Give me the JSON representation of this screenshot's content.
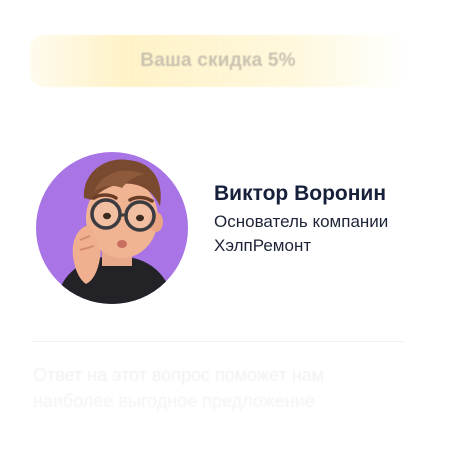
{
  "discount": {
    "label": "Ваша скидка 5%"
  },
  "author": {
    "name": "Виктор Воронин",
    "role_line1": "Основатель компании",
    "role_line2": "ХэлпРемонт",
    "avatar_bg": "#a874e6"
  },
  "hint": {
    "line1": "Ответ на этот вопрос поможет нам",
    "line2": "наиболее выгодное предложение"
  },
  "colors": {
    "name": "#17203a",
    "discount_text": "#c9c2b0",
    "discount_bg": "#fff0be"
  }
}
